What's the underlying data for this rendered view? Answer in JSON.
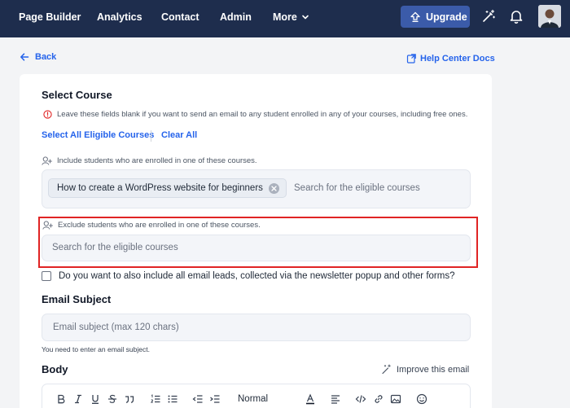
{
  "nav": {
    "items": [
      "Page Builder",
      "Analytics",
      "Contact",
      "Admin"
    ],
    "more_label": "More",
    "upgrade_label": "Upgrade"
  },
  "back_label": "Back",
  "help_label": "Help Center Docs",
  "course_section": {
    "title": "Select Course",
    "info_note": "Leave these fields blank if you want to send an email to any student enrolled in any of your courses, including free ones.",
    "select_all_label": "Select All Eligible Courses",
    "clear_all_label": "Clear All",
    "include_label": "Include students who are enrolled in one of these courses.",
    "include_chip": "How to create a WordPress website for beginners",
    "include_placeholder": "Search for the eligible courses",
    "exclude_label": "Exclude students who are enrolled in one of these courses.",
    "exclude_placeholder": "Search for the eligible courses",
    "leads_checkbox_label": "Do you want to also include all email leads, collected via the newsletter popup and other forms?",
    "leads_checked": false
  },
  "subject_section": {
    "title": "Email Subject",
    "placeholder": "Email subject (max 120 chars)",
    "hint": "You need to enter an email subject."
  },
  "body_section": {
    "title": "Body",
    "improve_label": "Improve this email",
    "format_value": "Normal"
  },
  "colors": {
    "nav_bg": "#1e2d4d",
    "accent": "#2563eb",
    "upgrade_bg": "#3b5ba9",
    "highlight": "#e02424"
  }
}
